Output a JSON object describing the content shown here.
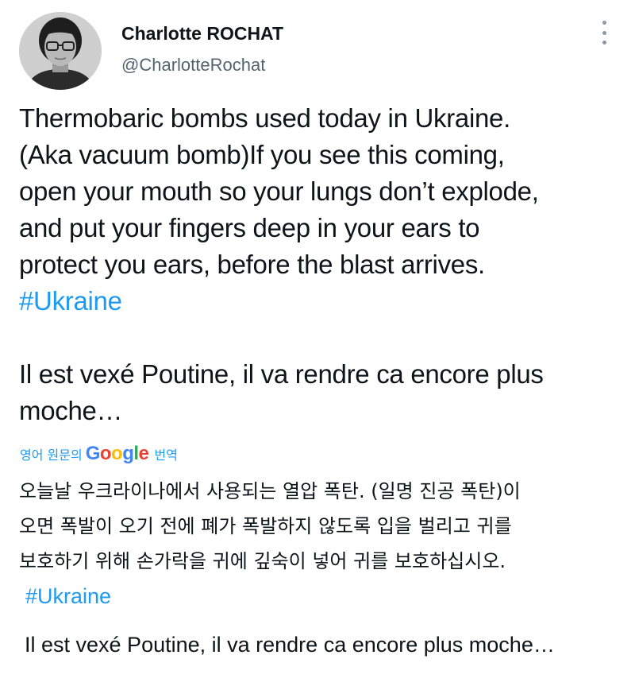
{
  "author": {
    "display_name": "Charlotte ROCHAT",
    "handle": "@CharlotteRochat",
    "avatar_icon": "profile-photo"
  },
  "menu": {
    "icon": "more-vertical-icon"
  },
  "tweet": {
    "lines": [
      "Thermobaric bombs used today in Ukraine.",
      "(Aka vacuum bomb)If you see this coming,",
      "open your mouth so your lungs don’t explode,",
      "and put your fingers deep in your ears to",
      "protect you ears, before the blast arrives."
    ],
    "hashtag": "#Ukraine",
    "french_lines": [
      "Il est vexé Poutine, il va rendre ca encore plus",
      "moche…"
    ]
  },
  "translation": {
    "prefix": "영어 원문의",
    "google_letters": [
      {
        "ch": "G",
        "color": "#4285f4"
      },
      {
        "ch": "o",
        "color": "#ea4335"
      },
      {
        "ch": "o",
        "color": "#fbbc05"
      },
      {
        "ch": "g",
        "color": "#4285f4"
      },
      {
        "ch": "l",
        "color": "#34a853"
      },
      {
        "ch": "e",
        "color": "#ea4335"
      }
    ],
    "suffix": "번역",
    "lines": [
      "오늘날 우크라이나에서 사용되는 열압 폭탄. (일명 진공 폭탄)이",
      "오면 폭발이 오기 전에 폐가 폭발하지 않도록 입을 벌리고 귀를",
      "보호하기 위해 손가락을 귀에 깊숙이 넣어 귀를 보호하십시오."
    ],
    "hashtag": "#Ukraine",
    "french": "Il est vexé Poutine, il va rendre ca encore plus moche…"
  },
  "colors": {
    "link": "#1d9bf0",
    "text": "#0f1419",
    "secondary": "#536471"
  }
}
